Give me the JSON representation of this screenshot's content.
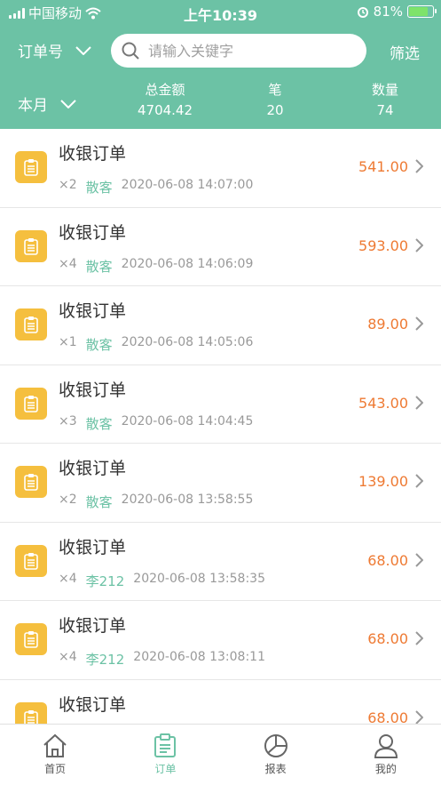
{
  "status": {
    "carrier": "中国移动",
    "time": "上午10:39",
    "battery": "81%"
  },
  "header": {
    "order_type": "订单号",
    "search_placeholder": "请输入关键字",
    "filter": "筛选",
    "period": "本月",
    "stats": [
      {
        "label": "总金额",
        "value": "4704.42"
      },
      {
        "label": "笔",
        "value": "20"
      },
      {
        "label": "数量",
        "value": "74"
      }
    ]
  },
  "orders": [
    {
      "title": "收银订单",
      "qty": "×2",
      "customer": "散客",
      "datetime": "2020-06-08 14:07:00",
      "amount": "541.00"
    },
    {
      "title": "收银订单",
      "qty": "×4",
      "customer": "散客",
      "datetime": "2020-06-08 14:06:09",
      "amount": "593.00"
    },
    {
      "title": "收银订单",
      "qty": "×1",
      "customer": "散客",
      "datetime": "2020-06-08 14:05:06",
      "amount": "89.00"
    },
    {
      "title": "收银订单",
      "qty": "×3",
      "customer": "散客",
      "datetime": "2020-06-08 14:04:45",
      "amount": "543.00"
    },
    {
      "title": "收银订单",
      "qty": "×2",
      "customer": "散客",
      "datetime": "2020-06-08 13:58:55",
      "amount": "139.00"
    },
    {
      "title": "收银订单",
      "qty": "×4",
      "customer": "李212",
      "datetime": "2020-06-08 13:58:35",
      "amount": "68.00"
    },
    {
      "title": "收银订单",
      "qty": "×4",
      "customer": "李212",
      "datetime": "2020-06-08 13:08:11",
      "amount": "68.00"
    },
    {
      "title": "收银订单",
      "qty": "",
      "customer": "",
      "datetime": "",
      "amount": "68.00"
    }
  ],
  "tabs": [
    {
      "label": "首页",
      "icon": "home-icon"
    },
    {
      "label": "订单",
      "icon": "order-icon",
      "active": true
    },
    {
      "label": "报表",
      "icon": "report-icon"
    },
    {
      "label": "我的",
      "icon": "profile-icon"
    }
  ],
  "colors": {
    "primary": "#6cc2a5",
    "amount": "#ee7a33",
    "order_icon_bg": "#f5bf3e"
  }
}
